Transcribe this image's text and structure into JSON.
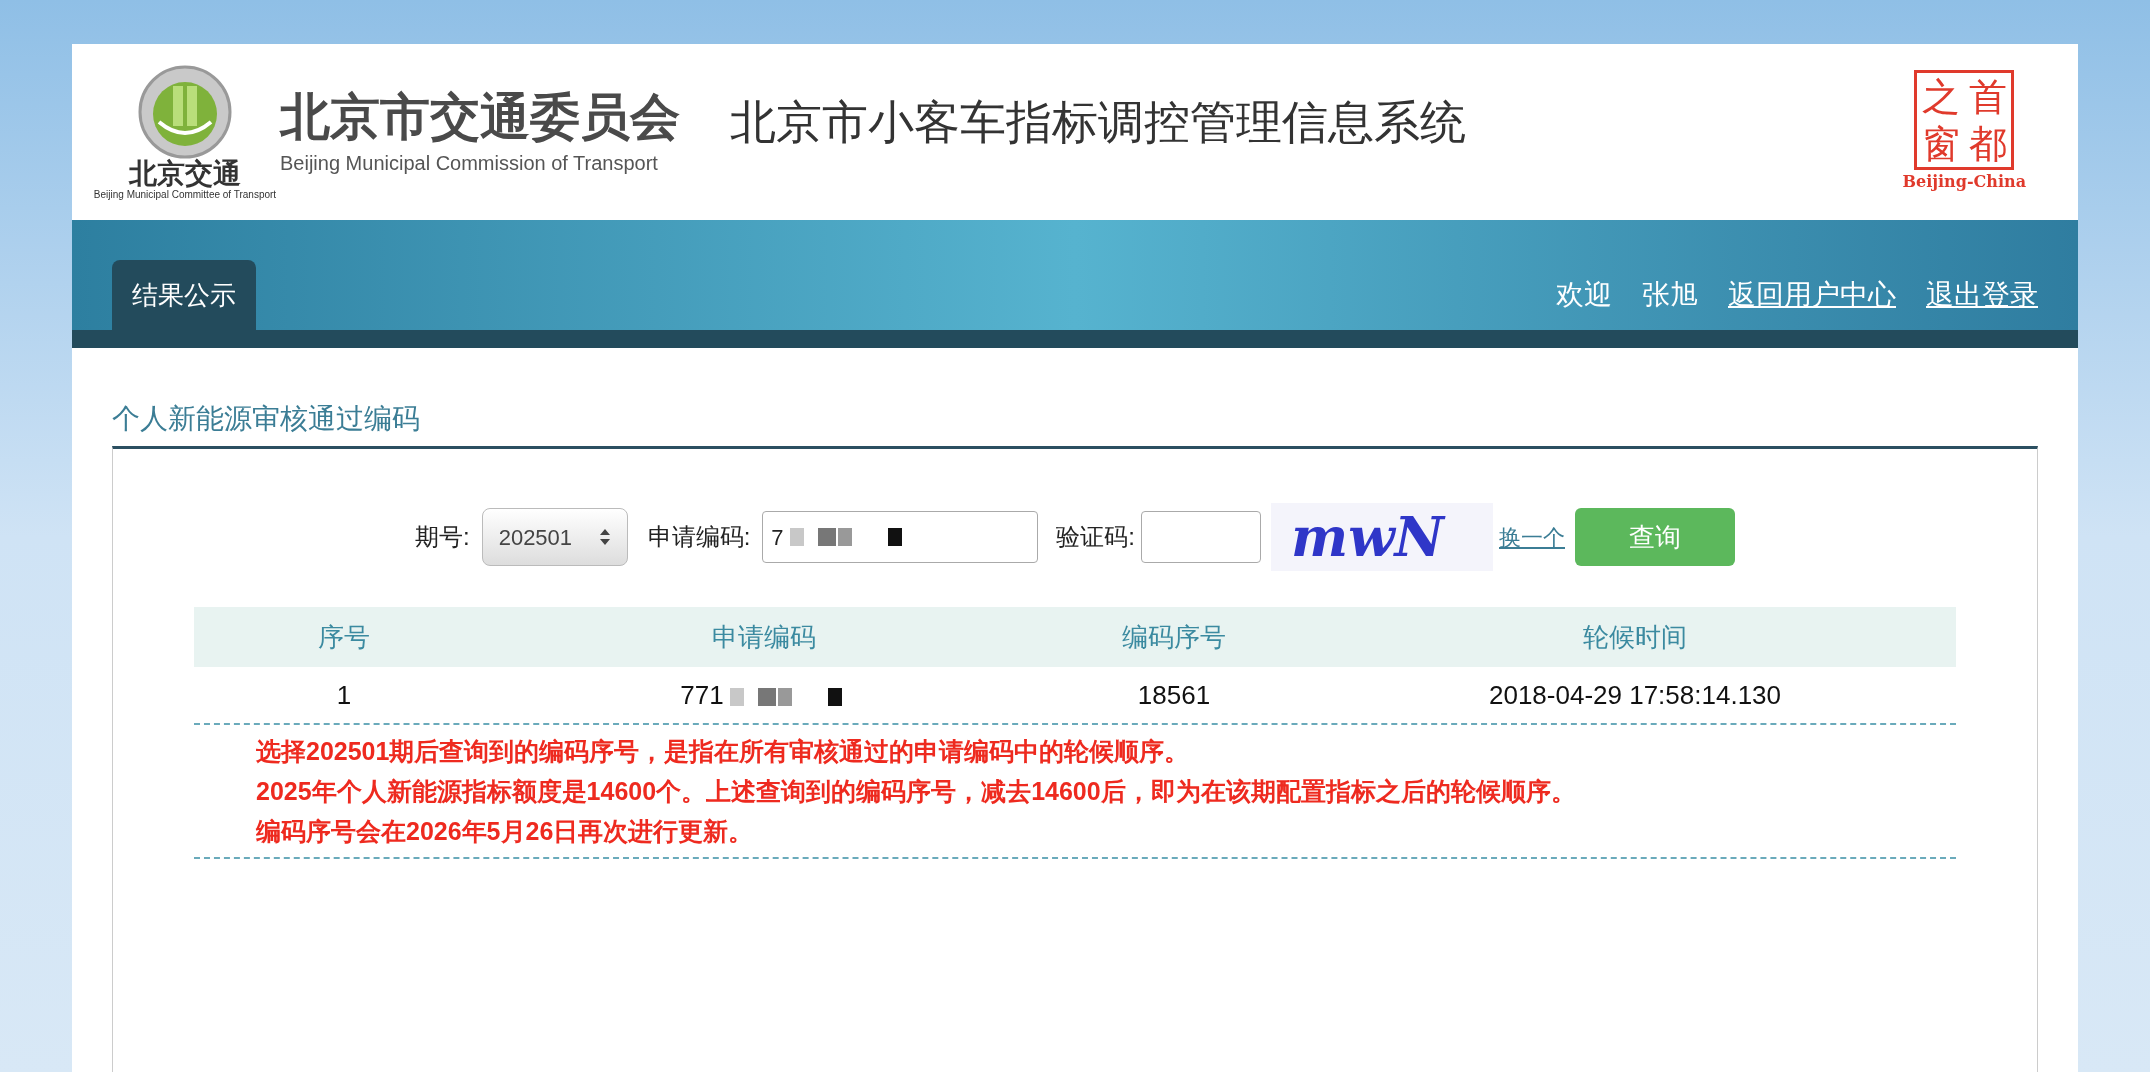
{
  "header": {
    "logo_caption": "北京交通",
    "logo_subcaption": "Beijing Municipal Committee of Transport",
    "org_name": "北京市交通委员会",
    "org_name_en": "Beijing Municipal Commission of Transport",
    "system_title": "北京市小客车指标调控管理信息系统",
    "seal_chars": [
      "之",
      "首",
      "窗",
      "都"
    ],
    "seal_caption": "Beijing-China"
  },
  "nav": {
    "tabs": [
      {
        "label": "结果公示",
        "selected": true
      }
    ],
    "welcome": "欢迎",
    "user": "张旭",
    "links": [
      "返回用户中心",
      "退出登录"
    ]
  },
  "section_title": "个人新能源审核通过编码",
  "form": {
    "period_label": "期号:",
    "period_value": "202501",
    "code_label": "申请编码:",
    "code_value": "7",
    "captcha_label": "验证码:",
    "captcha_text": "mwN",
    "refresh_link": "换一个",
    "submit": "查询"
  },
  "table": {
    "columns": [
      "序号",
      "申请编码",
      "编码序号",
      "轮候时间"
    ],
    "rows": [
      [
        "1",
        "771",
        "18561",
        "2018-04-29 17:58:14.130"
      ]
    ]
  },
  "notes": [
    "选择202501期后查询到的编码序号，是指在所有审核通过的申请编码中的轮候顺序。",
    "2025年个人新能源指标额度是14600个。上述查询到的编码序号，减去14600后，即为在该期配置指标之后的轮候顺序。",
    "编码序号会在2026年5月26日再次进行更新。"
  ]
}
